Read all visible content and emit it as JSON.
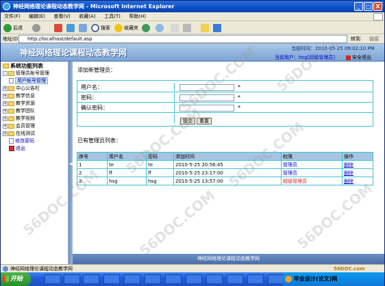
{
  "window": {
    "title": "神经网络理论课程动态教学网 - Microsoft Internet Explorer",
    "minimize": "_",
    "maximize": "□",
    "close": "X"
  },
  "menu": [
    "文件(F)",
    "编辑(E)",
    "查看(V)",
    "收藏(A)",
    "工具(T)",
    "帮助(H)"
  ],
  "toolbar": {
    "back": "后退",
    "search": "搜索",
    "favorites": "收藏夹"
  },
  "address": {
    "label": "地址(D)",
    "url": "http://localhost/default.asp",
    "go": "转到",
    "links": "链接"
  },
  "banner": {
    "site_name": "神经网络理论课程动态教学网",
    "time": "当前时间：2010-05-25 09:02:10 PM",
    "user": "当前用户：hsg[超级管理员]",
    "logout": "安全退出"
  },
  "sidebar": {
    "title": "系统功能列表",
    "items": [
      {
        "label": "管理员帐号管理",
        "type": "folder-open",
        "toggle": "-"
      },
      {
        "label": "用户帐号管理",
        "type": "page",
        "selected": true
      },
      {
        "label": "中心公告栏",
        "type": "folder",
        "toggle": "+"
      },
      {
        "label": "教学信息",
        "type": "folder",
        "toggle": "+"
      },
      {
        "label": "教学资源",
        "type": "folder",
        "toggle": "+"
      },
      {
        "label": "教学团队",
        "type": "folder",
        "toggle": "+"
      },
      {
        "label": "教学视频",
        "type": "folder",
        "toggle": "+"
      },
      {
        "label": "会员管理",
        "type": "folder",
        "toggle": "+"
      },
      {
        "label": "在线测试",
        "type": "folder",
        "toggle": "+"
      },
      {
        "label": "修改密码",
        "type": "page"
      },
      {
        "label": "退出",
        "type": "exit"
      }
    ]
  },
  "main": {
    "add_title": "添加新管理员：",
    "form": {
      "username_label": "用户名：",
      "password_label": "密码：",
      "confirm_label": "确认密码：",
      "required_mark": "*",
      "submit": "提交",
      "reset": "重置"
    },
    "list_title": "已有管理员列表：",
    "table": {
      "headers": [
        "序号",
        "用户名",
        "密码",
        "添加时间",
        "权限",
        "操作"
      ],
      "rows": [
        {
          "id": "1",
          "username": "te",
          "password": "te",
          "added": "2010-5-25 20:56:45",
          "permission": "管理员",
          "action": "删除"
        },
        {
          "id": "2",
          "username": "ff",
          "password": "ff",
          "added": "2010-5-25 23:17:00",
          "permission": "管理员",
          "action": "删除"
        },
        {
          "id": "3",
          "username": "hsg",
          "password": "hsg",
          "added": "2010-5-25 13:57:00",
          "permission": "超级管理员",
          "action": "删除"
        }
      ]
    },
    "footer": "神经网络理论课程动态教学网"
  },
  "status": {
    "text": "神经网络理论课程动态教学网",
    "brand": "56DOC.com"
  },
  "taskbar": {
    "start": "开始",
    "tray": "毕业设计(论文)网"
  },
  "watermark": "56DOC.COM",
  "colors": {
    "accent": "#245edb",
    "grid": "#3cc3d3",
    "super_admin": "#e02020"
  }
}
